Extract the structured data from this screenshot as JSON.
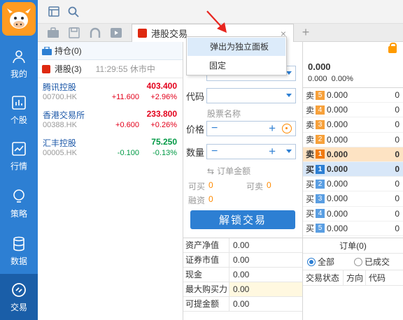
{
  "nav": {
    "items": [
      {
        "label": "我的",
        "icon": "user-icon"
      },
      {
        "label": "个股",
        "icon": "chart-bars-icon"
      },
      {
        "label": "行情",
        "icon": "trend-icon"
      },
      {
        "label": "策略",
        "icon": "bulb-icon"
      },
      {
        "label": "数据",
        "icon": "database-icon"
      },
      {
        "label": "交易",
        "icon": "exchange-icon"
      }
    ],
    "active": "交易"
  },
  "tab": {
    "label": "港股交易",
    "close": "×",
    "add": "+"
  },
  "popup": {
    "item1": "弹出为独立面板",
    "item2": "固定"
  },
  "holdings": {
    "header": "持仓(0)",
    "market": "港股(3)",
    "time": "11:29:55 休市中",
    "stocks": [
      {
        "name": "腾讯控股",
        "code": "00700.HK",
        "price": "403.400",
        "change": "+11.600",
        "pct": "+2.96%"
      },
      {
        "name": "香港交易所",
        "code": "00388.HK",
        "price": "233.800",
        "change": "+0.600",
        "pct": "+0.26%"
      },
      {
        "name": "汇丰控股",
        "code": "00005.HK",
        "price": "75.250",
        "change": "-0.100",
        "pct": "-0.13%"
      }
    ]
  },
  "form": {
    "code_label": "代码",
    "stock_name_hint": "股票名称",
    "price_label": "价格",
    "qty_label": "数量",
    "minus": "−",
    "plus": "+",
    "order_amount": "订单金额",
    "can_buy_label": "可买",
    "can_buy": "0",
    "can_sell_label": "可卖",
    "can_sell": "0",
    "margin_label": "融资",
    "margin": "0",
    "unlock_button": "解锁交易"
  },
  "account": {
    "rows": [
      {
        "label": "资产净值",
        "value": "0.00"
      },
      {
        "label": "证券市值",
        "value": "0.00"
      },
      {
        "label": "现金",
        "value": "0.00"
      },
      {
        "label": "最大购买力",
        "value": "0.00"
      },
      {
        "label": "可提金额",
        "value": "0.00"
      }
    ]
  },
  "quote": {
    "price": "0.000",
    "change": "0.000",
    "change_pct": "0.00%",
    "sell_side": "卖",
    "buy_side": "买",
    "sells": [
      {
        "level": "5",
        "price": "0.000",
        "vol": "0"
      },
      {
        "level": "4",
        "price": "0.000",
        "vol": "0"
      },
      {
        "level": "3",
        "price": "0.000",
        "vol": "0"
      },
      {
        "level": "2",
        "price": "0.000",
        "vol": "0"
      },
      {
        "level": "1",
        "price": "0.000",
        "vol": "0"
      }
    ],
    "buys": [
      {
        "level": "1",
        "price": "0.000",
        "vol": "0"
      },
      {
        "level": "2",
        "price": "0.000",
        "vol": "0"
      },
      {
        "level": "3",
        "price": "0.000",
        "vol": "0"
      },
      {
        "level": "4",
        "price": "0.000",
        "vol": "0"
      },
      {
        "level": "5",
        "price": "0.000",
        "vol": "0"
      }
    ]
  },
  "orders": {
    "title": "订单(0)",
    "filter_all": "全部",
    "filter_done": "已成交",
    "col_status": "交易状态",
    "col_dir": "方向",
    "col_code": "代码"
  },
  "colors": {
    "brand": "#2d7fd3",
    "up": "#e3001b",
    "down": "#009944",
    "accent": "#ff8a00"
  }
}
